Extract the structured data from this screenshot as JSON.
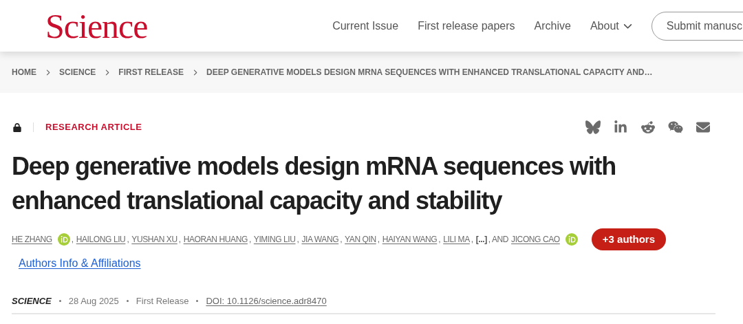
{
  "header": {
    "logo": "Science",
    "nav": [
      {
        "label": "Current Issue",
        "dropdown": false
      },
      {
        "label": "First release papers",
        "dropdown": false
      },
      {
        "label": "Archive",
        "dropdown": false
      },
      {
        "label": "About",
        "dropdown": true
      }
    ],
    "submit_button": "Submit manusc"
  },
  "breadcrumb": [
    "HOME",
    "SCIENCE",
    "FIRST RELEASE",
    "DEEP GENERATIVE MODELS DESIGN MRNA SEQUENCES WITH ENHANCED TRANSLATIONAL CAPACITY AND…"
  ],
  "article": {
    "locked": true,
    "type": "RESEARCH ARTICLE",
    "title": "Deep generative models design mRNA sequences with enhanced translational capacity and stability",
    "authors": [
      {
        "kind": "author",
        "name": "HE ZHANG",
        "orcid": true
      },
      {
        "kind": "text",
        "text": ","
      },
      {
        "kind": "author",
        "name": "HAILONG LIU",
        "orcid": false
      },
      {
        "kind": "text",
        "text": ","
      },
      {
        "kind": "author",
        "name": "YUSHAN XU",
        "orcid": false
      },
      {
        "kind": "text",
        "text": ","
      },
      {
        "kind": "author",
        "name": "HAORAN HUANG",
        "orcid": false
      },
      {
        "kind": "text",
        "text": ","
      },
      {
        "kind": "author",
        "name": "YIMING LIU",
        "orcid": false
      },
      {
        "kind": "text",
        "text": ","
      },
      {
        "kind": "author",
        "name": "JIA WANG",
        "orcid": false
      },
      {
        "kind": "text",
        "text": ","
      },
      {
        "kind": "author",
        "name": "YAN QIN",
        "orcid": false
      },
      {
        "kind": "text",
        "text": ","
      },
      {
        "kind": "author",
        "name": "HAIYAN WANG",
        "orcid": false
      },
      {
        "kind": "text",
        "text": ","
      },
      {
        "kind": "author",
        "name": "LILI MA",
        "orcid": false
      },
      {
        "kind": "text",
        "text": ","
      },
      {
        "kind": "more",
        "text": "[...]"
      },
      {
        "kind": "text",
        "text": ", AND"
      },
      {
        "kind": "author",
        "name": "JICONG CAO",
        "orcid": true
      }
    ],
    "more_authors": "+3 authors",
    "affiliations_link": "Authors Info & Affiliations",
    "meta": {
      "journal": "SCIENCE",
      "date": "28 Aug 2025",
      "status": "First Release",
      "doi": "DOI: 10.1126/science.adr8470"
    }
  }
}
